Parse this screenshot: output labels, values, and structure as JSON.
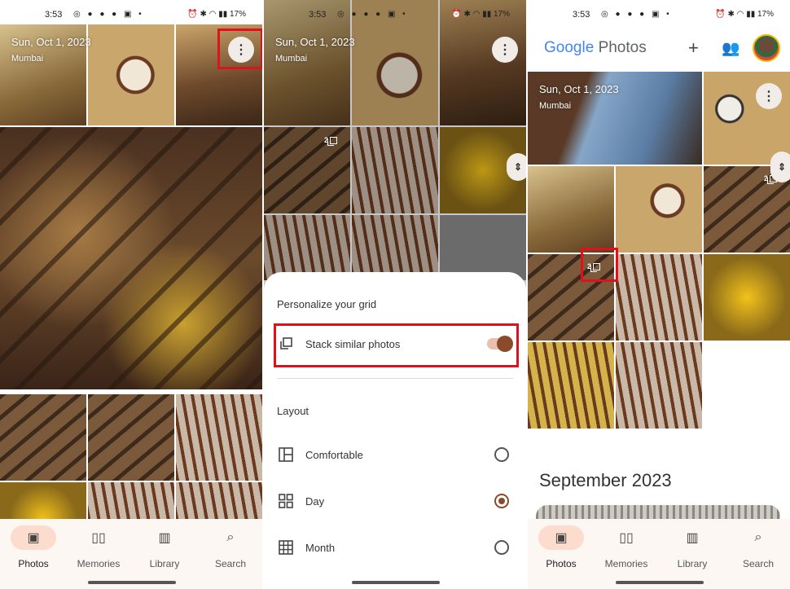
{
  "status": {
    "time": "3:53",
    "battery": "17%",
    "left_icons": "◎ ● ● ● ▣ •",
    "right_icons": "⏰ ✱ ◠ ▮▮"
  },
  "panel1": {
    "date": "Sun, Oct 1, 2023",
    "place": "Mumbai"
  },
  "panel2": {
    "date": "Sun, Oct 1, 2023",
    "place": "Mumbai",
    "stack_count": "2",
    "sheet": {
      "title": "Personalize your grid",
      "stack_label": "Stack similar photos",
      "stack_enabled": true,
      "layout_title": "Layout",
      "options": [
        {
          "label": "Comfortable",
          "selected": false
        },
        {
          "label": "Day",
          "selected": true
        },
        {
          "label": "Month",
          "selected": false
        }
      ]
    }
  },
  "panel3": {
    "app_title_google": "Google",
    "app_title_photos": "Photos",
    "date": "Sun, Oct 1, 2023",
    "place": "Mumbai",
    "stack_count": "2",
    "stack_count_right": "2",
    "month_heading": "September 2023"
  },
  "nav": [
    {
      "label": "Photos",
      "icon": "image-icon",
      "active": true
    },
    {
      "label": "Memories",
      "icon": "memories-icon",
      "active": false
    },
    {
      "label": "Library",
      "icon": "library-icon",
      "active": false
    },
    {
      "label": "Search",
      "icon": "search-icon",
      "active": false
    }
  ],
  "colors": {
    "accent": "#8b4a2b",
    "highlight_box": "#e0101c",
    "nav_active_pill": "#fbdccd"
  }
}
